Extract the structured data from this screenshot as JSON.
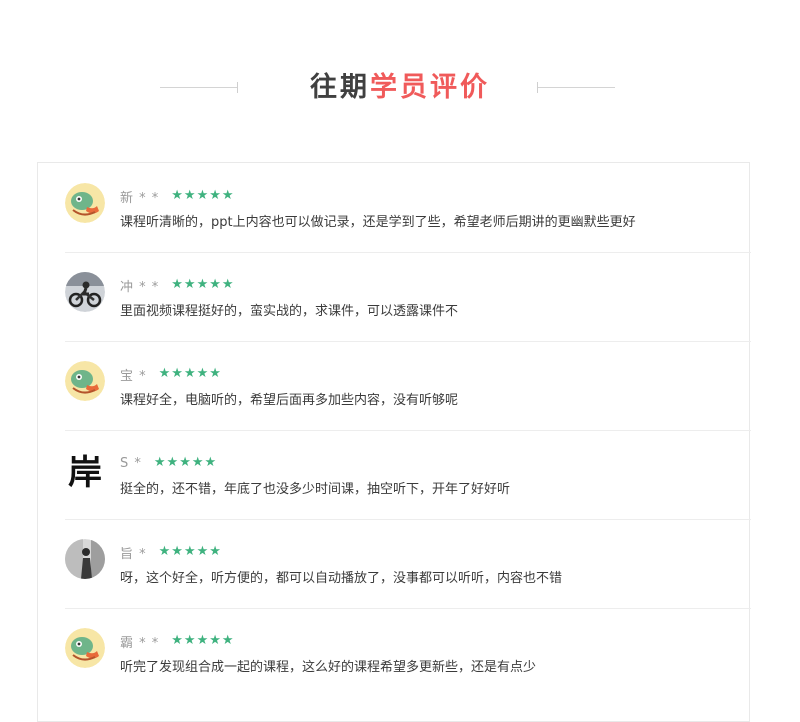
{
  "section": {
    "title_part1": "往期",
    "title_part2": "学员评价"
  },
  "colors": {
    "accent_red": "#f05a5a",
    "title_dark": "#404040",
    "star_green": "#3fb27f"
  },
  "reviews": [
    {
      "name": "新 * *",
      "rating": 5,
      "avatar": "cartoon-avatar",
      "text": "课程听清晰的，ppt上内容也可以做记录，还是学到了些，希望老师后期讲的更幽默些更好"
    },
    {
      "name": "冲 * *",
      "rating": 5,
      "avatar": "motorcycle-avatar",
      "text": "里面视频课程挺好的，蛮实战的，求课件，可以透露课件不"
    },
    {
      "name": "宝 *",
      "rating": 5,
      "avatar": "cartoon-avatar",
      "text": "课程好全，电脑听的，希望后面再多加些内容，没有听够呢"
    },
    {
      "name": "S *",
      "rating": 5,
      "avatar": "calligraphy-avatar",
      "calligraphy_char": "岸",
      "text": "挺全的，还不错，年底了也没多少时间课，抽空听下，开年了好好听"
    },
    {
      "name": "旨 *",
      "rating": 5,
      "avatar": "photo-avatar",
      "text": "呀，这个好全，听方便的，都可以自动播放了，没事都可以听听，内容也不错"
    },
    {
      "name": "霸 * *",
      "rating": 5,
      "avatar": "cartoon-avatar",
      "text": "听完了发现组合成一起的课程，这么好的课程希望多更新些，还是有点少"
    }
  ]
}
